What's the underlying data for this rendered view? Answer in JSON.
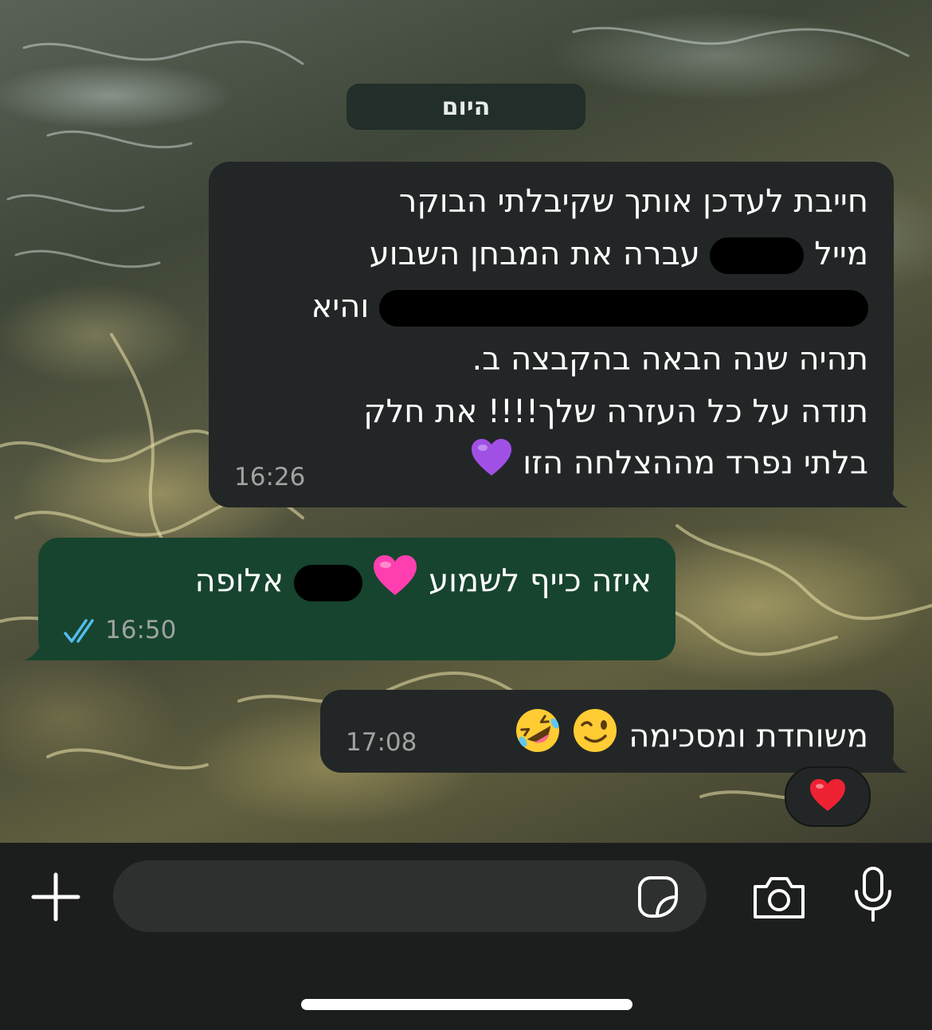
{
  "date_separator": "היום",
  "messages": [
    {
      "direction": "incoming",
      "lines": [
        "חייבת לעדכן אותך שקיבלתי הבוקר",
        [
          "מייל",
          "עברה את המבחן השבוע"
        ],
        [
          "",
          "והיא"
        ],
        "תהיה שנה הבאה בהקבצה ב.",
        "תודה על כל העזרה שלך!!!! את חלק",
        "בלתי נפרד מההצלחה הזו"
      ],
      "emoji": "purple-heart",
      "time": "16:26"
    },
    {
      "direction": "outgoing",
      "parts": [
        "איזה כייף לשמוע",
        "אלופה"
      ],
      "emoji": "pink-heart",
      "time": "16:50",
      "status": "read"
    },
    {
      "direction": "incoming",
      "text": "משוחדת ומסכימה",
      "emojis": [
        "winking-face",
        "rolling-on-floor-laughing"
      ],
      "time": "17:08",
      "reaction": "red-heart"
    }
  ],
  "composer": {
    "placeholder": "",
    "icons": [
      "plus-icon",
      "sticker-icon",
      "camera-icon",
      "microphone-icon"
    ]
  },
  "colors": {
    "incoming_bubble": "#232626",
    "outgoing_bubble": "#17442f",
    "read_ticks": "#53bdeb"
  }
}
